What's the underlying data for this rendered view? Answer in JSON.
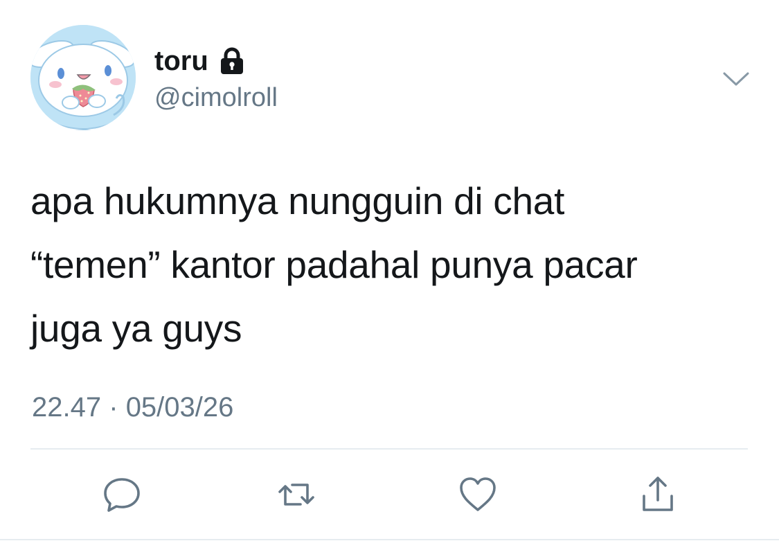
{
  "author": {
    "display_name": "toru",
    "handle": "@cimolroll",
    "protected": true,
    "avatar_icon": "cinnamoroll-avatar"
  },
  "tweet": {
    "text": "apa hukumnya nungguin di chat\n“temen” kantor padahal punya pacar\njuga ya guys",
    "time": "22.47",
    "separator": "·",
    "date": "05/03/26"
  },
  "actions": [
    {
      "name": "reply",
      "icon": "reply-icon"
    },
    {
      "name": "retweet",
      "icon": "retweet-icon"
    },
    {
      "name": "like",
      "icon": "heart-icon"
    },
    {
      "name": "share",
      "icon": "share-icon"
    }
  ],
  "menu": {
    "icon": "chevron-down-icon"
  },
  "colors": {
    "text": "#14171a",
    "secondary": "#657786",
    "divider": "#e6ecf0",
    "icon": "#657786",
    "avatar_bg": "#bfe3f6"
  }
}
